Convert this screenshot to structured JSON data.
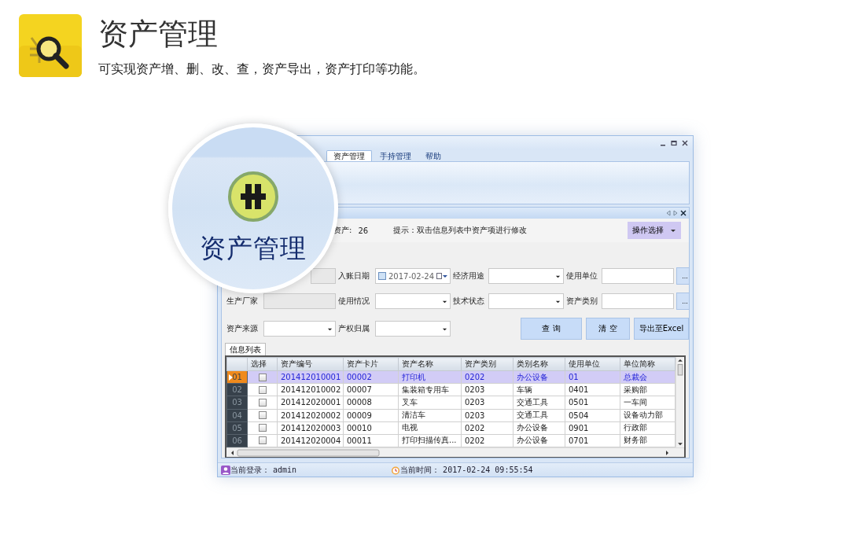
{
  "header": {
    "title": "资产管理",
    "subtitle": "可实现资产增、删、改、查，资产导出，资产打印等功能。"
  },
  "window": {
    "tabs": [
      {
        "label": "资产管理",
        "selected": true
      },
      {
        "label": "手持管理",
        "selected": false
      },
      {
        "label": "帮助",
        "selected": false
      }
    ],
    "info": {
      "count_label": "资产:",
      "count": "26",
      "hint": "提示：双击信息列表中资产项进行修改",
      "action": "操作选择"
    },
    "form": {
      "rows": [
        [
          {
            "kind": "input"
          },
          {
            "label": "入账日期",
            "kind": "date",
            "value": "2017-02-24"
          },
          {
            "label": "经济用途",
            "kind": "select"
          },
          {
            "label": "使用单位",
            "kind": "browse",
            "button": "..."
          }
        ],
        [
          {
            "label": "生产厂家",
            "kind": "input"
          },
          {
            "label": "使用情况",
            "kind": "select"
          },
          {
            "label": "技术状态",
            "kind": "select"
          },
          {
            "label": "资产类别",
            "kind": "browse",
            "button": "..."
          }
        ],
        [
          {
            "label": "资产来源",
            "kind": "select"
          },
          {
            "label": "产权归属",
            "kind": "select"
          }
        ]
      ]
    },
    "buttons": [
      "查 询",
      "清 空",
      "导出至Excel"
    ],
    "list_tab": "信息列表",
    "grid": {
      "select_column": "选择",
      "columns": [
        "资产编号",
        "资产卡片",
        "资产名称",
        "资产类别",
        "类别名称",
        "使用单位",
        "单位简称"
      ],
      "rows": [
        {
          "number": "01",
          "selected": true,
          "checked": false,
          "cells": [
            "201412010001",
            "00002",
            "打印机",
            "0202",
            "办公设备",
            "01",
            "总裁会"
          ]
        },
        {
          "number": "02",
          "selected": false,
          "checked": false,
          "cells": [
            "201412010002",
            "00007",
            "集装箱专用车",
            "0203",
            "车辆",
            "0401",
            "采购部"
          ]
        },
        {
          "number": "03",
          "selected": false,
          "checked": false,
          "cells": [
            "201412020001",
            "00008",
            "叉车",
            "0203",
            "交通工具",
            "0501",
            "一车间"
          ]
        },
        {
          "number": "04",
          "selected": false,
          "checked": false,
          "cells": [
            "201412020002",
            "00009",
            "清洁车",
            "0203",
            "交通工具",
            "0504",
            "设备动力部"
          ]
        },
        {
          "number": "05",
          "selected": false,
          "checked": false,
          "cells": [
            "201412020003",
            "00010",
            "电视",
            "0202",
            "办公设备",
            "0901",
            "行政部"
          ]
        },
        {
          "number": "06",
          "selected": false,
          "checked": false,
          "cells": [
            "201412020004",
            "00011",
            "打印扫描传真...",
            "0202",
            "办公设备",
            "0701",
            "财务部"
          ]
        }
      ]
    },
    "status": {
      "login_label": "当前登录：",
      "user": "admin",
      "time_label": "当前时间：",
      "time": "2017-02-24 09:55:54"
    }
  },
  "lens": {
    "label": "资产管理"
  }
}
